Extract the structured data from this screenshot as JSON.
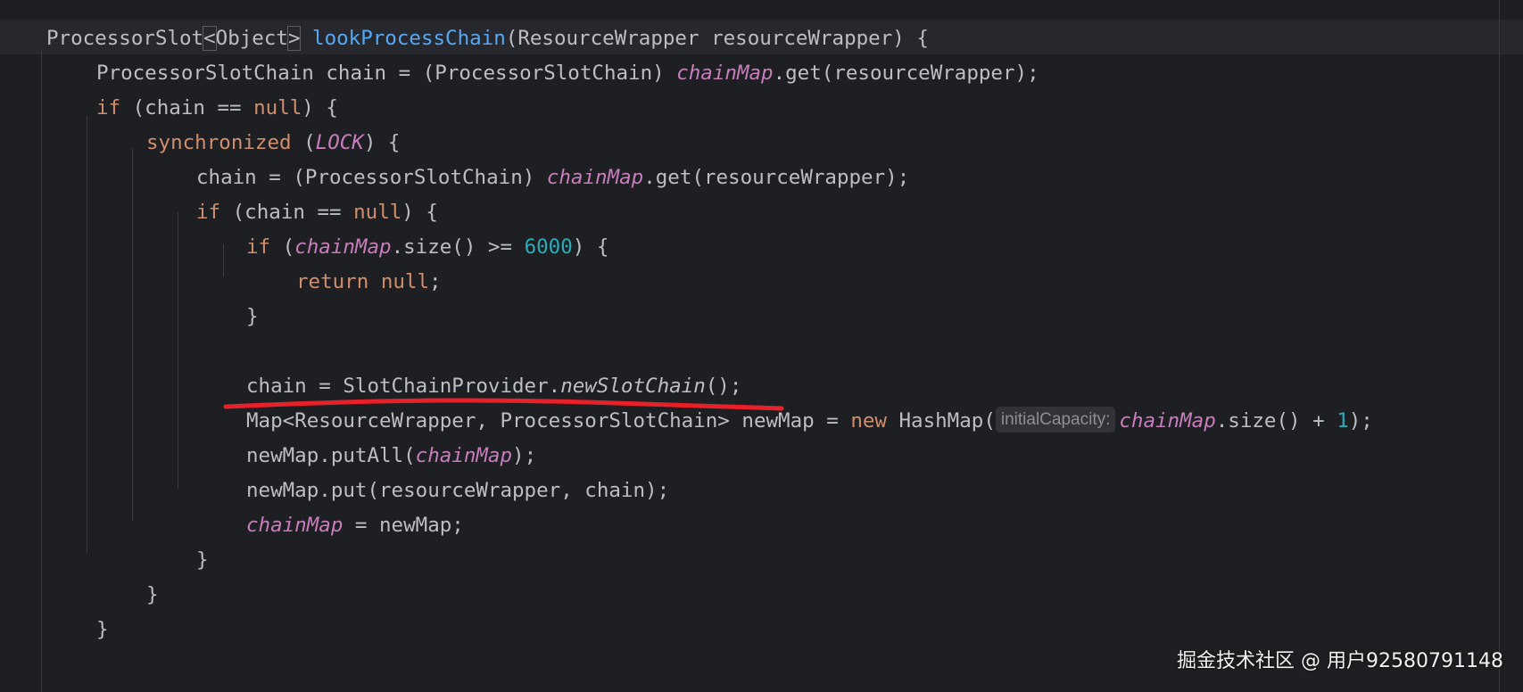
{
  "editor": {
    "theme_colors": {
      "background": "#1e1f22",
      "caret_row": "#26282e",
      "keyword": "#cf8e6d",
      "function_declaration": "#56a8f5",
      "field": "#c77dbb",
      "number": "#2aacb8",
      "text": "#bcbec4",
      "annotation_underline": "#e8202a"
    },
    "lines": [
      {
        "tokens": [
          {
            "t": "ProcessorSlot",
            "c": "plain"
          },
          {
            "t": "<",
            "c": "brk"
          },
          {
            "t": "Object",
            "c": "plain"
          },
          {
            "t": ">",
            "c": "brk"
          },
          {
            "t": " ",
            "c": "plain"
          },
          {
            "t": "lookProcessChain",
            "c": "fn"
          },
          {
            "t": "(ResourceWrapper resourceWrapper) {",
            "c": "plain"
          }
        ]
      },
      {
        "tokens": [
          {
            "t": "ProcessorSlotChain chain = (ProcessorSlotChain) ",
            "c": "plain"
          },
          {
            "t": "chainMap",
            "c": "field"
          },
          {
            "t": ".get(resourceWrapper);",
            "c": "plain"
          }
        ]
      },
      {
        "tokens": [
          {
            "t": "if",
            "c": "kw"
          },
          {
            "t": " (chain == ",
            "c": "plain"
          },
          {
            "t": "null",
            "c": "kw"
          },
          {
            "t": ") {",
            "c": "plain"
          }
        ]
      },
      {
        "tokens": [
          {
            "t": "synchronized",
            "c": "kw"
          },
          {
            "t": " (",
            "c": "plain"
          },
          {
            "t": "LOCK",
            "c": "static"
          },
          {
            "t": ") {",
            "c": "plain"
          }
        ]
      },
      {
        "tokens": [
          {
            "t": "chain = (ProcessorSlotChain) ",
            "c": "plain"
          },
          {
            "t": "chainMap",
            "c": "field"
          },
          {
            "t": ".get(resourceWrapper);",
            "c": "plain"
          }
        ]
      },
      {
        "tokens": [
          {
            "t": "if",
            "c": "kw"
          },
          {
            "t": " (chain == ",
            "c": "plain"
          },
          {
            "t": "null",
            "c": "kw"
          },
          {
            "t": ") {",
            "c": "plain"
          }
        ]
      },
      {
        "tokens": [
          {
            "t": "if",
            "c": "kw"
          },
          {
            "t": " (",
            "c": "plain"
          },
          {
            "t": "chainMap",
            "c": "field"
          },
          {
            "t": ".size() >= ",
            "c": "plain"
          },
          {
            "t": "6000",
            "c": "num"
          },
          {
            "t": ") {",
            "c": "plain"
          }
        ]
      },
      {
        "tokens": [
          {
            "t": "return",
            "c": "kw"
          },
          {
            "t": " ",
            "c": "plain"
          },
          {
            "t": "null",
            "c": "kw"
          },
          {
            "t": ";",
            "c": "plain"
          }
        ]
      },
      {
        "tokens": [
          {
            "t": "}",
            "c": "plain"
          }
        ]
      },
      {
        "tokens": []
      },
      {
        "tokens": [
          {
            "t": "chain = SlotChainProvider.",
            "c": "plain"
          },
          {
            "t": "newSlotChain",
            "c": "smethod"
          },
          {
            "t": "();",
            "c": "plain"
          }
        ]
      },
      {
        "tokens": [
          {
            "t": "Map<ResourceWrapper, ProcessorSlotChain> newMap = ",
            "c": "plain"
          },
          {
            "t": "new",
            "c": "kw"
          },
          {
            "t": " HashMap(",
            "c": "plain"
          },
          {
            "t": "initialCapacity:",
            "c": "inlay"
          },
          {
            "t": "chainMap",
            "c": "field"
          },
          {
            "t": ".size() + ",
            "c": "plain"
          },
          {
            "t": "1",
            "c": "num"
          },
          {
            "t": ");",
            "c": "plain"
          }
        ]
      },
      {
        "tokens": [
          {
            "t": "newMap.putAll(",
            "c": "plain"
          },
          {
            "t": "chainMap",
            "c": "field"
          },
          {
            "t": ");",
            "c": "plain"
          }
        ]
      },
      {
        "tokens": [
          {
            "t": "newMap.put(resourceWrapper, chain);",
            "c": "plain"
          }
        ]
      },
      {
        "tokens": [
          {
            "t": "chainMap",
            "c": "field"
          },
          {
            "t": " = newMap;",
            "c": "plain"
          }
        ]
      },
      {
        "tokens": [
          {
            "t": "}",
            "c": "plain"
          }
        ]
      },
      {
        "tokens": [
          {
            "t": "}",
            "c": "plain"
          }
        ]
      },
      {
        "tokens": [
          {
            "t": "}",
            "c": "plain"
          }
        ]
      }
    ]
  },
  "watermark": {
    "text": "掘金技术社区 @ 用户92580791148"
  }
}
